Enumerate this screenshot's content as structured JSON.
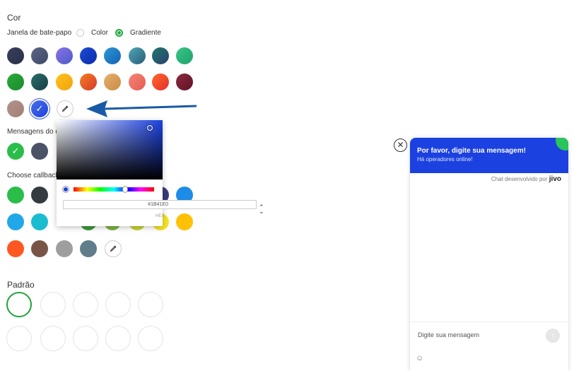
{
  "section": {
    "title": "Cor",
    "window_label": "Janela de bate-papo",
    "option_color": "Color",
    "option_gradient": "Gradiente",
    "messages_label": "Mensagens do d",
    "callback_label": "Choose callback",
    "pattern_title": "Padrão"
  },
  "window_swatches": [
    {
      "from": "#3a3f5a",
      "to": "#28304c"
    },
    {
      "from": "#5b6583",
      "to": "#3f4b6a"
    },
    {
      "from": "#8a73e8",
      "to": "#4b5ac9"
    },
    {
      "from": "#1c49d8",
      "to": "#0b2ea8"
    },
    {
      "from": "#2a9ad6",
      "to": "#1560b3"
    },
    {
      "from": "#4fa6b6",
      "to": "#2a5d78"
    },
    {
      "from": "#1e7a6c",
      "to": "#2b3f6f"
    },
    {
      "from": "#38c58a",
      "to": "#1fa36a"
    },
    {
      "from": "#2caa3a",
      "to": "#1a8b2b"
    },
    {
      "from": "#2a6d6a",
      "to": "#173f44"
    },
    {
      "from": "#ffc21d",
      "to": "#f2a20d"
    },
    {
      "from": "#f47b20",
      "to": "#d63a2b"
    },
    {
      "from": "#e6b06e",
      "to": "#c98b44"
    },
    {
      "from": "#f58574",
      "to": "#e55c53"
    },
    {
      "from": "#ff6a2a",
      "to": "#e52e2e"
    },
    {
      "from": "#8d2a3f",
      "to": "#5f1226"
    },
    {
      "from": "#b2928c",
      "to": "#a38077"
    },
    {
      "from": "#4a6ee8",
      "to": "#1b41e0"
    }
  ],
  "selected_color_hex": "#1B41E0",
  "hex_mode_label": "HEX",
  "message_swatches": [
    "#2bbd4a",
    "#4a5466"
  ],
  "callback_swatches": [
    "#2bbd4a",
    "#343a40",
    "#3a3a7a",
    "#1d8ce8",
    "#22a8e8",
    "#1bbcd0",
    "#3c9a3c",
    "#7cb342",
    "#c5d331",
    "#f5e324",
    "#ffc107",
    "#ff5722",
    "#795548",
    "#9e9e9e",
    "#607d8b"
  ],
  "chat": {
    "title": "Por favor, digite sua mensagem!",
    "subtitle": "Há operadores online!",
    "powered_by": "Chat desenvolvido por",
    "brand": "jivo",
    "input_placeholder": "Digite sua mensagem",
    "accent": "#1B41E0",
    "corner": "#29c45c"
  }
}
